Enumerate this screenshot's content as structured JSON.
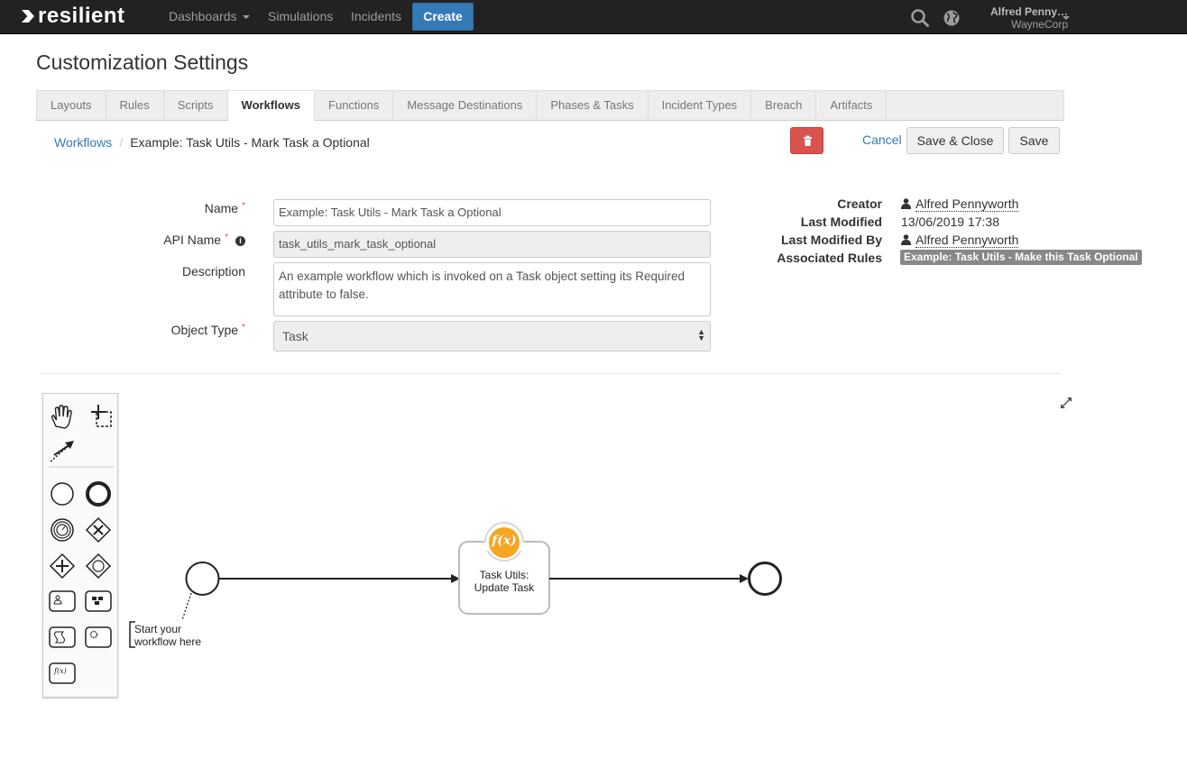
{
  "navbar": {
    "brand": "resilient",
    "items": [
      "Dashboards",
      "Simulations",
      "Incidents"
    ],
    "create_label": "Create",
    "user_name": "Alfred Penny…",
    "org_name": "WayneCorp"
  },
  "page": {
    "title": "Customization Settings"
  },
  "tabs": [
    "Layouts",
    "Rules",
    "Scripts",
    "Workflows",
    "Functions",
    "Message Destinations",
    "Phases & Tasks",
    "Incident Types",
    "Breach",
    "Artifacts"
  ],
  "active_tab": "Workflows",
  "breadcrumb": {
    "parent": "Workflows",
    "separator": "/",
    "current": "Example: Task Utils - Mark Task a Optional"
  },
  "actions": {
    "cancel_label": "Cancel",
    "save_close_label": "Save & Close",
    "save_label": "Save"
  },
  "form": {
    "name_label": "Name",
    "name_value": "Example: Task Utils - Mark Task a Optional",
    "api_name_label": "API Name",
    "api_name_value": "task_utils_mark_task_optional",
    "description_label": "Description",
    "description_value": "An example workflow which is invoked on a Task object setting its Required attribute to false.",
    "object_type_label": "Object Type",
    "object_type_value": "Task",
    "required_marker": "*",
    "info_glyph": "i"
  },
  "meta": {
    "creator_label": "Creator",
    "creator_value": "Alfred Pennyworth",
    "last_modified_label": "Last Modified",
    "last_modified_value": "13/06/2019 17:38",
    "last_modified_by_label": "Last Modified By",
    "last_modified_by_value": "Alfred Pennyworth",
    "associated_rules_label": "Associated Rules",
    "associated_rules_value": "Example: Task Utils - Make this Task Optional"
  },
  "diagram": {
    "task_label_line1": "Task Utils:",
    "task_label_line2": "Update Task",
    "start_hint_line1": "Start your",
    "start_hint_line2": "workflow here",
    "function_badge": "f(x)"
  },
  "colors": {
    "navbar_bg": "#222222",
    "primary": "#337ab7",
    "danger": "#d9534f",
    "function_badge": "#f5a623",
    "badge_gray": "#888888"
  }
}
